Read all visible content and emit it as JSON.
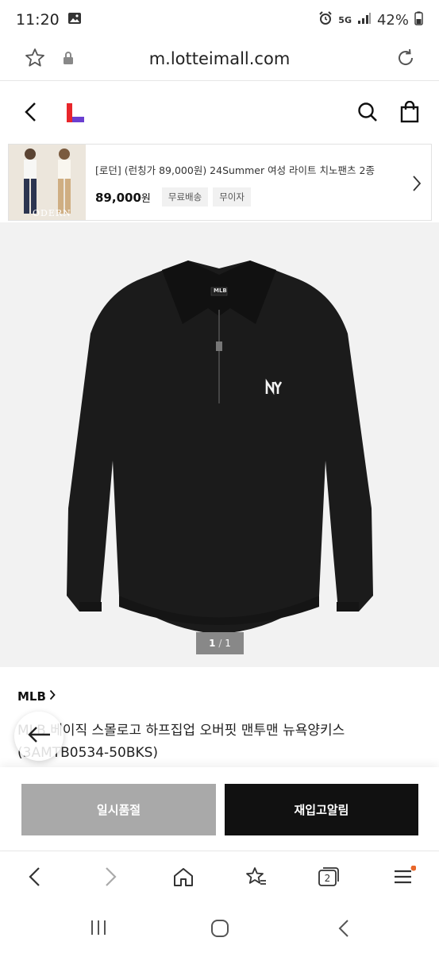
{
  "status": {
    "time": "11:20",
    "network": "5G",
    "battery": "42%"
  },
  "browser": {
    "url": "m.lotteimall.com"
  },
  "banner": {
    "title": "[로던] (런칭가 89,000원) 24Summer 여성 라이트 치노팬츠 2종",
    "price": "89,000",
    "price_unit": "원",
    "tags": [
      "무료배송",
      "무이자"
    ],
    "thumb_text": "ODERN"
  },
  "gallery": {
    "current": "1",
    "separator": "/",
    "total": "1"
  },
  "product": {
    "brand": "MLB",
    "name": "MLB 베이직 스몰로고 하프집업 오버핏 맨투맨 뉴욕양키스 (3AMTB0534-50BKS)",
    "logo_text": "MLB"
  },
  "actions": {
    "soldout_label": "일시품절",
    "restock_label": "재입고알림"
  },
  "browser_nav": {
    "tab_count": "2"
  },
  "colors": {
    "logo_red": "#e8262b",
    "logo_purple": "#6a3fd0",
    "dark_button": "#111111",
    "disabled_button": "#a9a9a9"
  }
}
